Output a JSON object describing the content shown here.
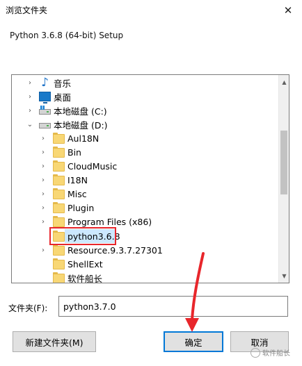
{
  "window": {
    "title": "浏览文件夹",
    "close_glyph": "✕"
  },
  "subtitle": "Python 3.6.8 (64-bit) Setup",
  "tree": {
    "items": [
      {
        "label": "音乐",
        "icon": "music-icon",
        "expander": "›"
      },
      {
        "label": "桌面",
        "icon": "desktop-icon",
        "expander": "›"
      },
      {
        "label": "本地磁盘 (C:)",
        "icon": "drive-c-icon",
        "expander": "›"
      },
      {
        "label": "本地磁盘 (D:)",
        "icon": "drive-d-icon",
        "expander": "⌄"
      },
      {
        "label": "Aul18N",
        "icon": "folder-icon",
        "expander": "›"
      },
      {
        "label": "Bin",
        "icon": "folder-icon",
        "expander": "›"
      },
      {
        "label": "CloudMusic",
        "icon": "folder-icon",
        "expander": "›"
      },
      {
        "label": "I18N",
        "icon": "folder-icon",
        "expander": "›"
      },
      {
        "label": "Misc",
        "icon": "folder-icon",
        "expander": "›"
      },
      {
        "label": "Plugin",
        "icon": "folder-icon",
        "expander": "›"
      },
      {
        "label": "Program Files (x86)",
        "icon": "folder-icon",
        "expander": "›"
      },
      {
        "label": "python3.6.8",
        "icon": "folder-icon",
        "expander": "",
        "selected": true
      },
      {
        "label": "Resource.9.3.7.27301",
        "icon": "folder-icon",
        "expander": "›"
      },
      {
        "label": "ShellExt",
        "icon": "folder-icon",
        "expander": ""
      },
      {
        "label": "软件船长",
        "icon": "folder-icon",
        "expander": ""
      }
    ]
  },
  "folder_field": {
    "label": "文件夹(F):",
    "value": "python3.7.0"
  },
  "buttons": {
    "new_folder": "新建文件夹(M)",
    "ok": "确定",
    "cancel": "取消"
  },
  "watermark": "软件船长",
  "colors": {
    "highlight": "#e8262b",
    "selection": "#cce8ff",
    "focus_border": "#0078d7"
  }
}
